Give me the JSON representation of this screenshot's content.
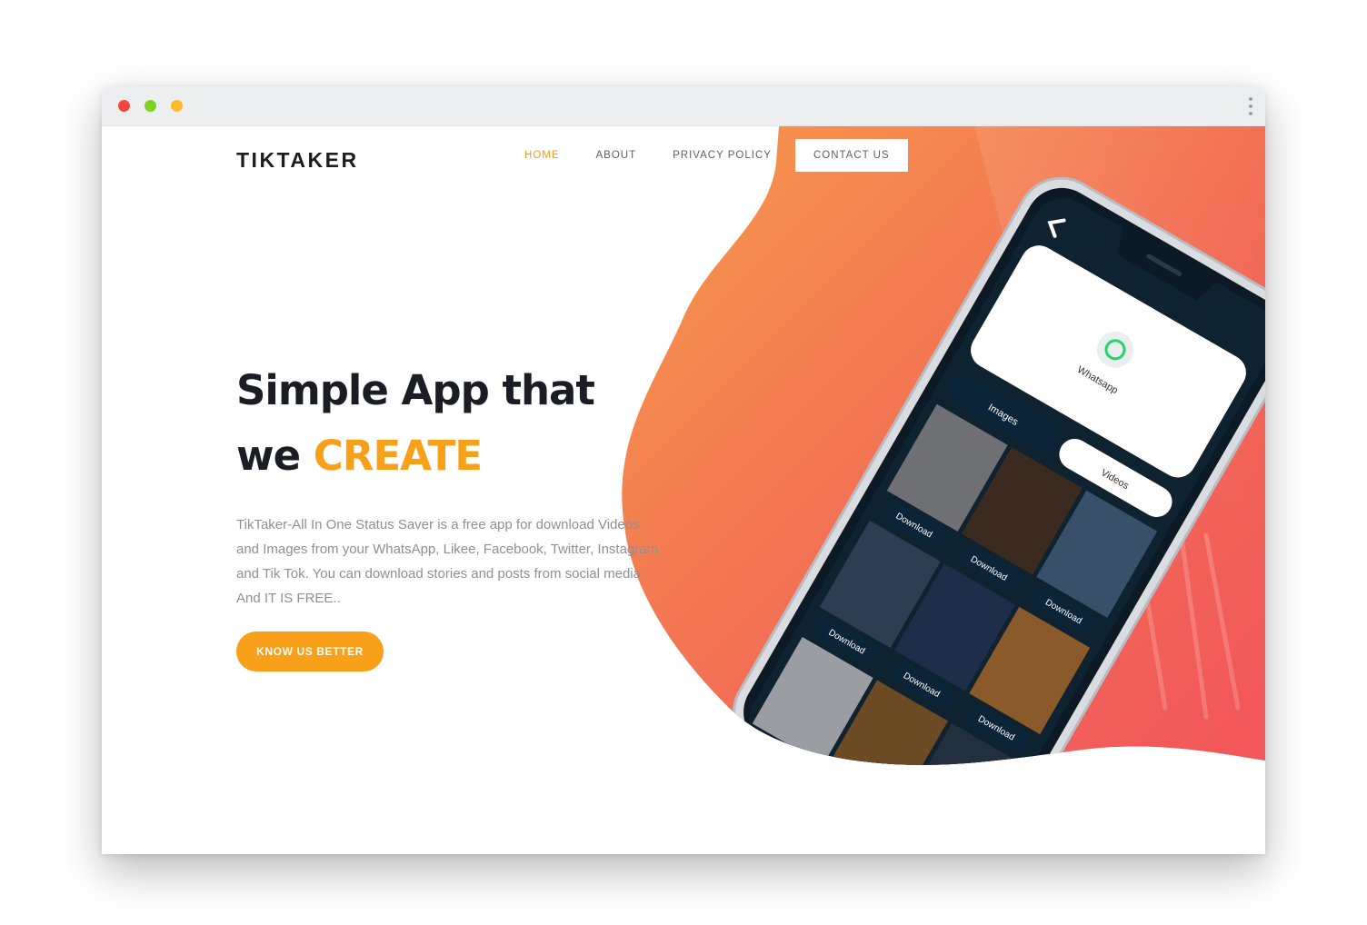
{
  "browser": {
    "controls": [
      "close",
      "minimize",
      "maximize"
    ],
    "menu_icon": "kebab-menu-icon"
  },
  "header": {
    "logo": "TIKTAKER",
    "nav": [
      {
        "label": "HOME",
        "active": true
      },
      {
        "label": "ABOUT",
        "active": false
      },
      {
        "label": "PRIVACY POLICY",
        "active": false
      },
      {
        "label": "CONTACT US",
        "active": false
      }
    ]
  },
  "hero": {
    "title_line1": "Simple App that",
    "title_line2_prefix": "we",
    "title_line2_accent": "CREATE",
    "description": "TikTaker-All In One Status Saver is a free app for download Videos and Images from your WhatsApp, Likee, Facebook, Twitter, Instagram and Tik Tok. You can download stories and posts from social media. And IT IS FREE..",
    "cta": "KNOW US BETTER"
  },
  "phone": {
    "app_name": "Whatsapp",
    "tabs": [
      "Images",
      "Videos"
    ],
    "download_label": "Download",
    "back_icon": "chevron-left-icon",
    "app_icon": "whatsapp-icon"
  },
  "colors": {
    "accent": "#f9a01b",
    "nav_active": "#f59a1e",
    "gradient_start": "#f79a4a",
    "gradient_end": "#f2555b",
    "dark": "#1c1c24"
  }
}
